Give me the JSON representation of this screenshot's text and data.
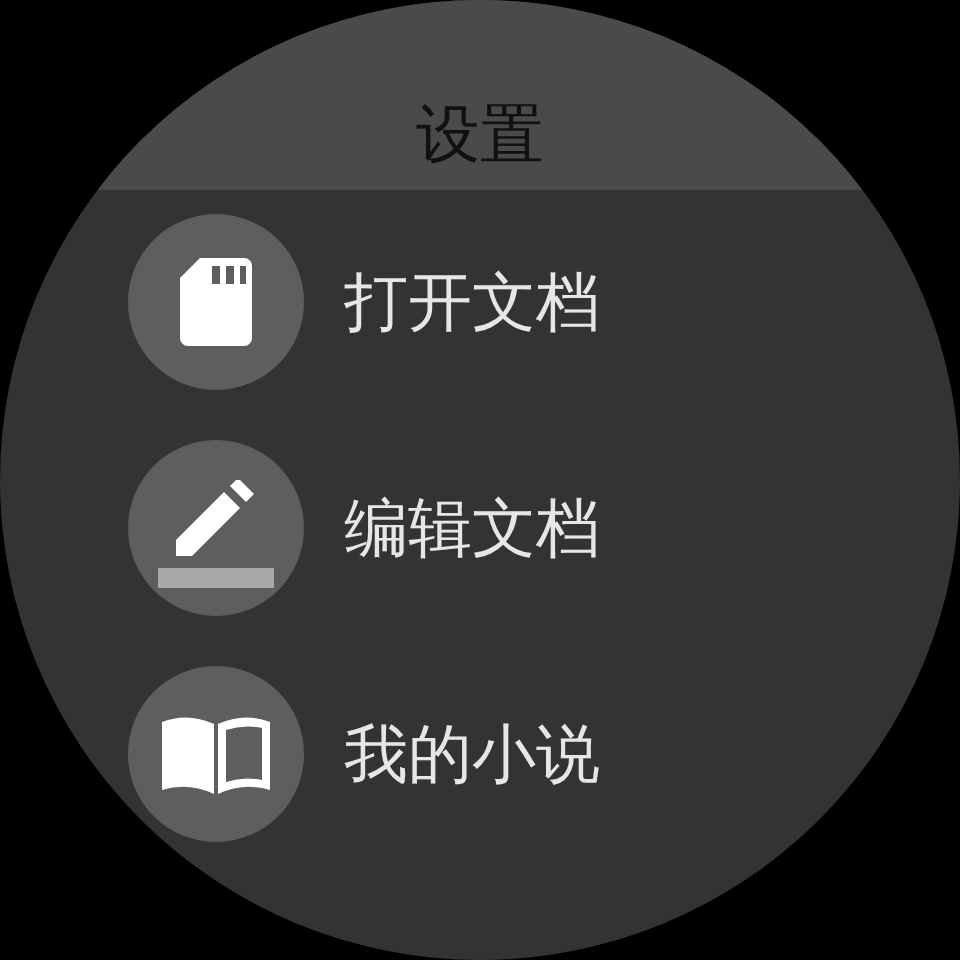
{
  "title": "设置",
  "items": [
    {
      "kind": "sdcard",
      "label": "打开文档"
    },
    {
      "kind": "edit",
      "label": "编辑文档"
    },
    {
      "kind": "book",
      "label": "我的小说"
    }
  ]
}
